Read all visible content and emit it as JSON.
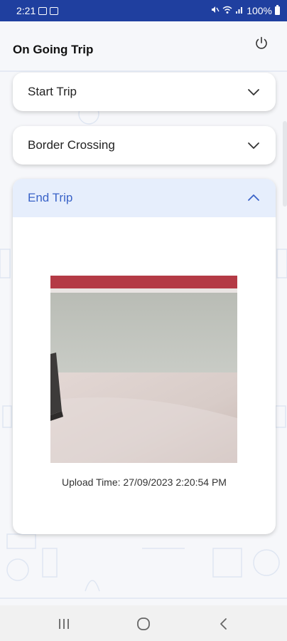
{
  "status_bar": {
    "time": "2:21",
    "battery": "100%"
  },
  "header": {
    "title": "On Going Trip"
  },
  "sections": [
    {
      "label": "Start Trip",
      "expanded": false
    },
    {
      "label": "Border Crossing",
      "expanded": false
    },
    {
      "label": "End Trip",
      "expanded": true
    }
  ],
  "end_trip": {
    "upload_time": "Upload Time: 27/09/2023 2:20:54 PM"
  },
  "colors": {
    "status_bar": "#1f3f9f",
    "accent": "#3a63c8",
    "expanded_header": "#e6eefc"
  },
  "icons": {
    "power": "power-icon",
    "collapsed": "chevron-down-icon",
    "expanded": "chevron-up-icon",
    "nav_recents": "recent-apps-icon",
    "nav_home": "home-icon",
    "nav_back": "back-icon"
  }
}
